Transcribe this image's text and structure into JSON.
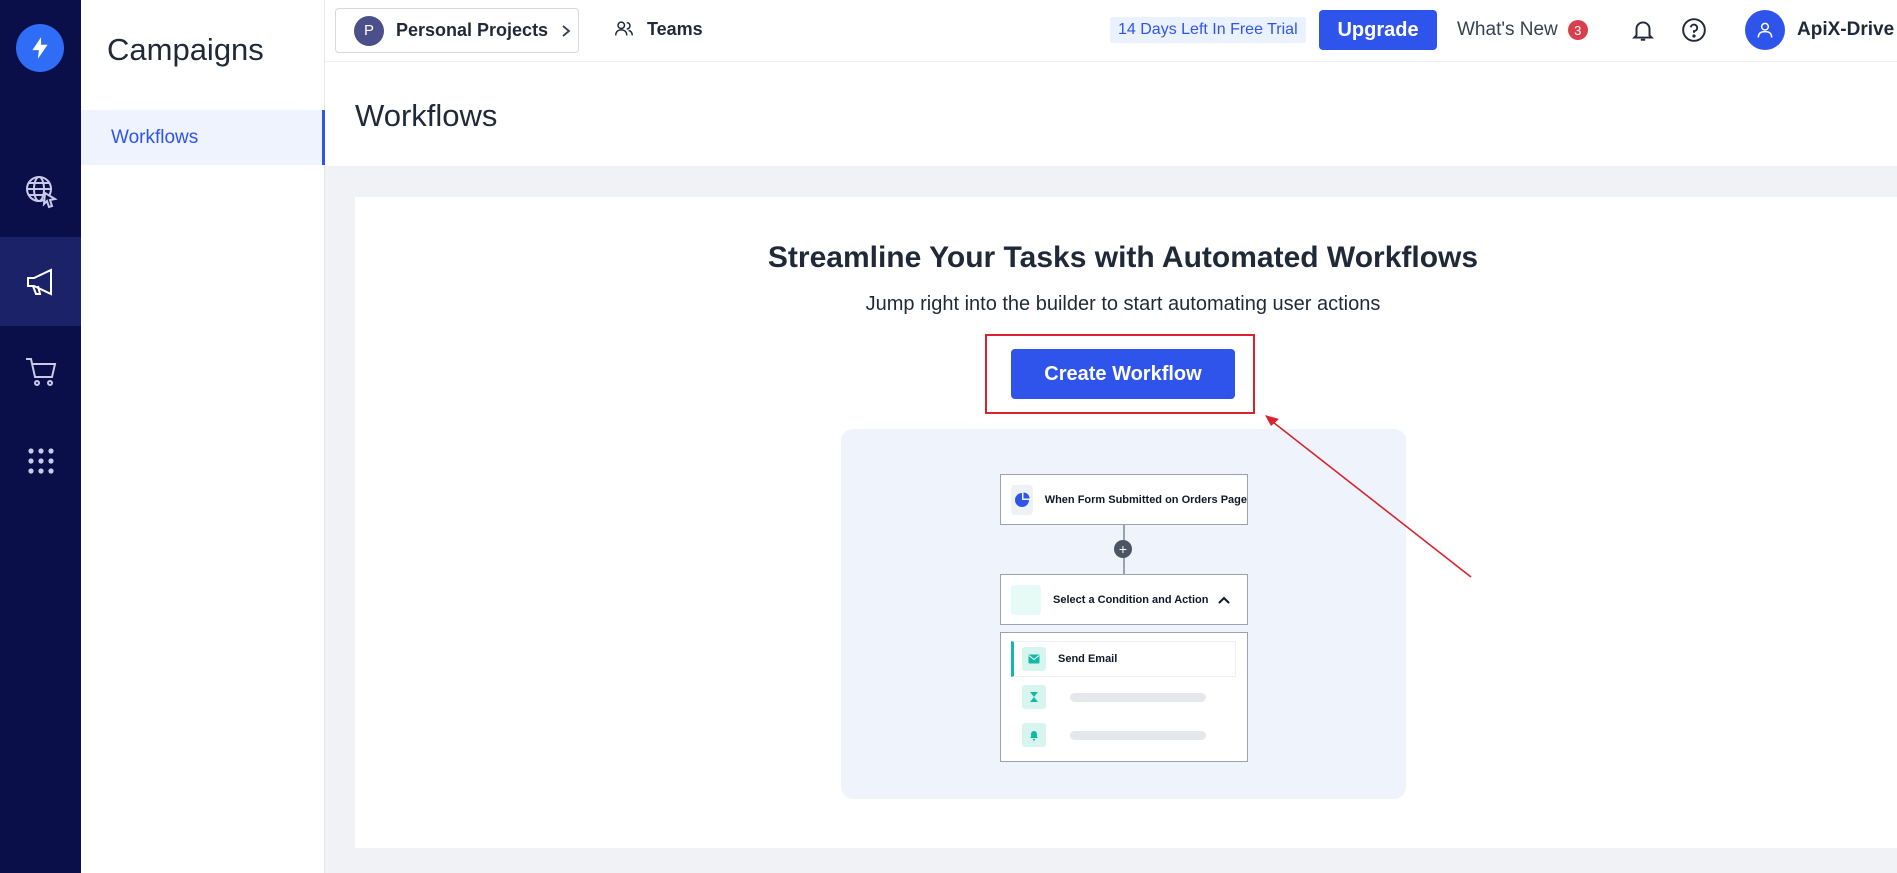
{
  "sidebar": {
    "title": "Campaigns",
    "items": [
      {
        "label": "Workflows"
      }
    ]
  },
  "topbar": {
    "project": {
      "initial": "P",
      "label": "Personal Projects"
    },
    "teams_label": "Teams",
    "trial_label": "14 Days Left In Free Trial",
    "upgrade_label": "Upgrade",
    "whats_new_label": "What's New",
    "whats_new_count": "3",
    "user_name": "ApiX-Drive"
  },
  "page": {
    "title": "Workflows"
  },
  "empty_state": {
    "headline": "Streamline Your Tasks with Automated Workflows",
    "subline": "Jump right into the builder to start automating user actions",
    "cta_label": "Create Workflow"
  },
  "preview": {
    "trigger_label": "When Form Submitted on Orders Page",
    "condition_label": "Select a Condition and Action",
    "action_label": "Send Email",
    "plus_symbol": "+"
  },
  "colors": {
    "rail_bg": "#0a0f4a",
    "primary": "#2f54eb",
    "highlight": "#d9232e",
    "teal": "#14b8a6"
  },
  "icons": {
    "rail": [
      "bolt-icon",
      "globe-cursor-icon",
      "megaphone-icon",
      "cart-icon",
      "grid-icon"
    ],
    "topbar": [
      "teams-icon",
      "bell-icon",
      "help-icon",
      "user-icon",
      "chevron-down-icon"
    ]
  }
}
